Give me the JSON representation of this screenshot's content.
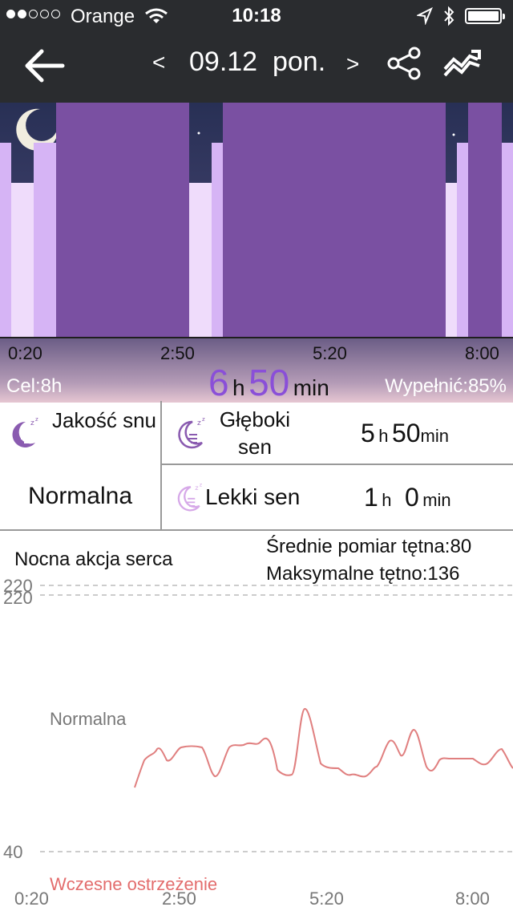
{
  "status_bar": {
    "carrier": "Orange",
    "time": "10:18",
    "signal_bars_filled": 2,
    "signal_bars_total": 5
  },
  "nav": {
    "prev_label": "<",
    "date": "09.12  pon.",
    "next_label": ">",
    "icons": [
      "back-arrow-icon",
      "share-icon",
      "trend-chart-icon"
    ]
  },
  "sleep_chart": {
    "ticks": [
      "0:20",
      "2:50",
      "5:20",
      "8:00"
    ],
    "goal": "Cel:8h",
    "total_hours": "6",
    "hours_unit": "h",
    "total_minutes": "50",
    "minutes_unit": "min",
    "fill": "Wypełnić:85%",
    "colors": {
      "deep": "#7a50a2",
      "light": "#d6b4f5",
      "awake": "#efdcfb",
      "sky": "#283055"
    }
  },
  "quality": {
    "label": "Jakość snu",
    "value": "Normalna"
  },
  "deep_sleep": {
    "label": "Głęboki sen",
    "hours": "5",
    "hours_unit": "h",
    "minutes": "50",
    "minutes_unit": "min"
  },
  "light_sleep": {
    "label": "Lekki sen",
    "hours": "1",
    "hours_unit": "h",
    "minutes": "0",
    "minutes_unit": "min"
  },
  "heart_rate": {
    "title": "Nocna akcja serca",
    "average": "Średnie pomiar tętna:80",
    "maximum": "Maksymalne tętno:136",
    "y_top": "220",
    "y_top_duplicate": "220",
    "y_bottom": "40",
    "normal_label": "Normalna",
    "warning_label": "Wczesne ostrzeżenie",
    "x_ticks": [
      "0:20",
      "2:50",
      "5:20",
      "8:00"
    ],
    "line_color": "#e07f7f"
  }
}
